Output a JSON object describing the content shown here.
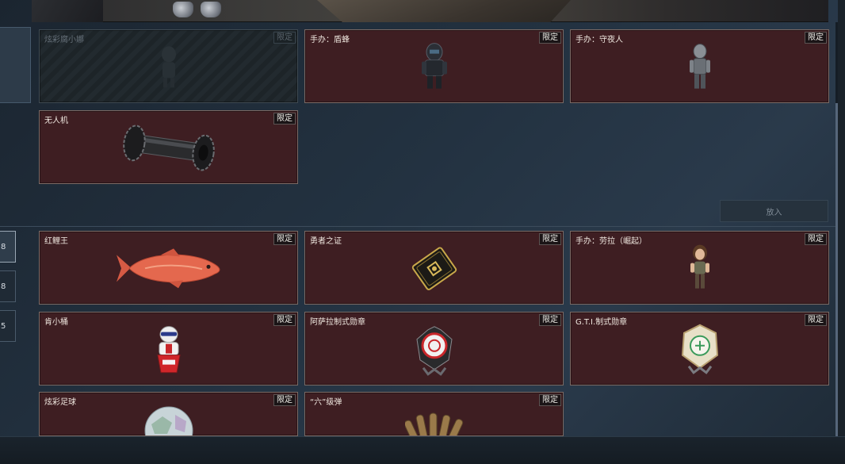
{
  "side_tabs": [
    "8",
    "8",
    "5"
  ],
  "put_button_label": "放入",
  "limit_label": "限定",
  "top_items": [
    {
      "name": "炫彩腐小娜",
      "disabled": true,
      "icon": "figure-silhouette-icon"
    },
    {
      "name": "手办：盾蜂",
      "disabled": false,
      "icon": "armored-figure-icon"
    },
    {
      "name": "手办：守夜人",
      "disabled": false,
      "icon": "robot-figure-icon"
    },
    {
      "name": "无人机",
      "disabled": false,
      "icon": "drone-tube-icon"
    }
  ],
  "bottom_items": [
    {
      "name": "红鲤王",
      "disabled": false,
      "icon": "red-carp-icon"
    },
    {
      "name": "勇者之证",
      "disabled": false,
      "icon": "card-emblem-icon"
    },
    {
      "name": "手办：劳拉（崛起）",
      "disabled": false,
      "icon": "lara-figure-icon"
    },
    {
      "name": "肯小桶",
      "disabled": false,
      "icon": "bucket-mascot-icon"
    },
    {
      "name": "阿萨拉制式勋章",
      "disabled": false,
      "icon": "red-medal-icon"
    },
    {
      "name": "G.T.I.制式勋章",
      "disabled": false,
      "icon": "green-medal-icon"
    },
    {
      "name": "炫彩足球",
      "disabled": false,
      "icon": "football-icon"
    },
    {
      "name": "“六”级弹",
      "disabled": false,
      "icon": "bullets-icon"
    }
  ],
  "colors": {
    "card_bg": "#3e1e22",
    "card_border": "#7b6a65",
    "panel_bg": "#233241"
  }
}
